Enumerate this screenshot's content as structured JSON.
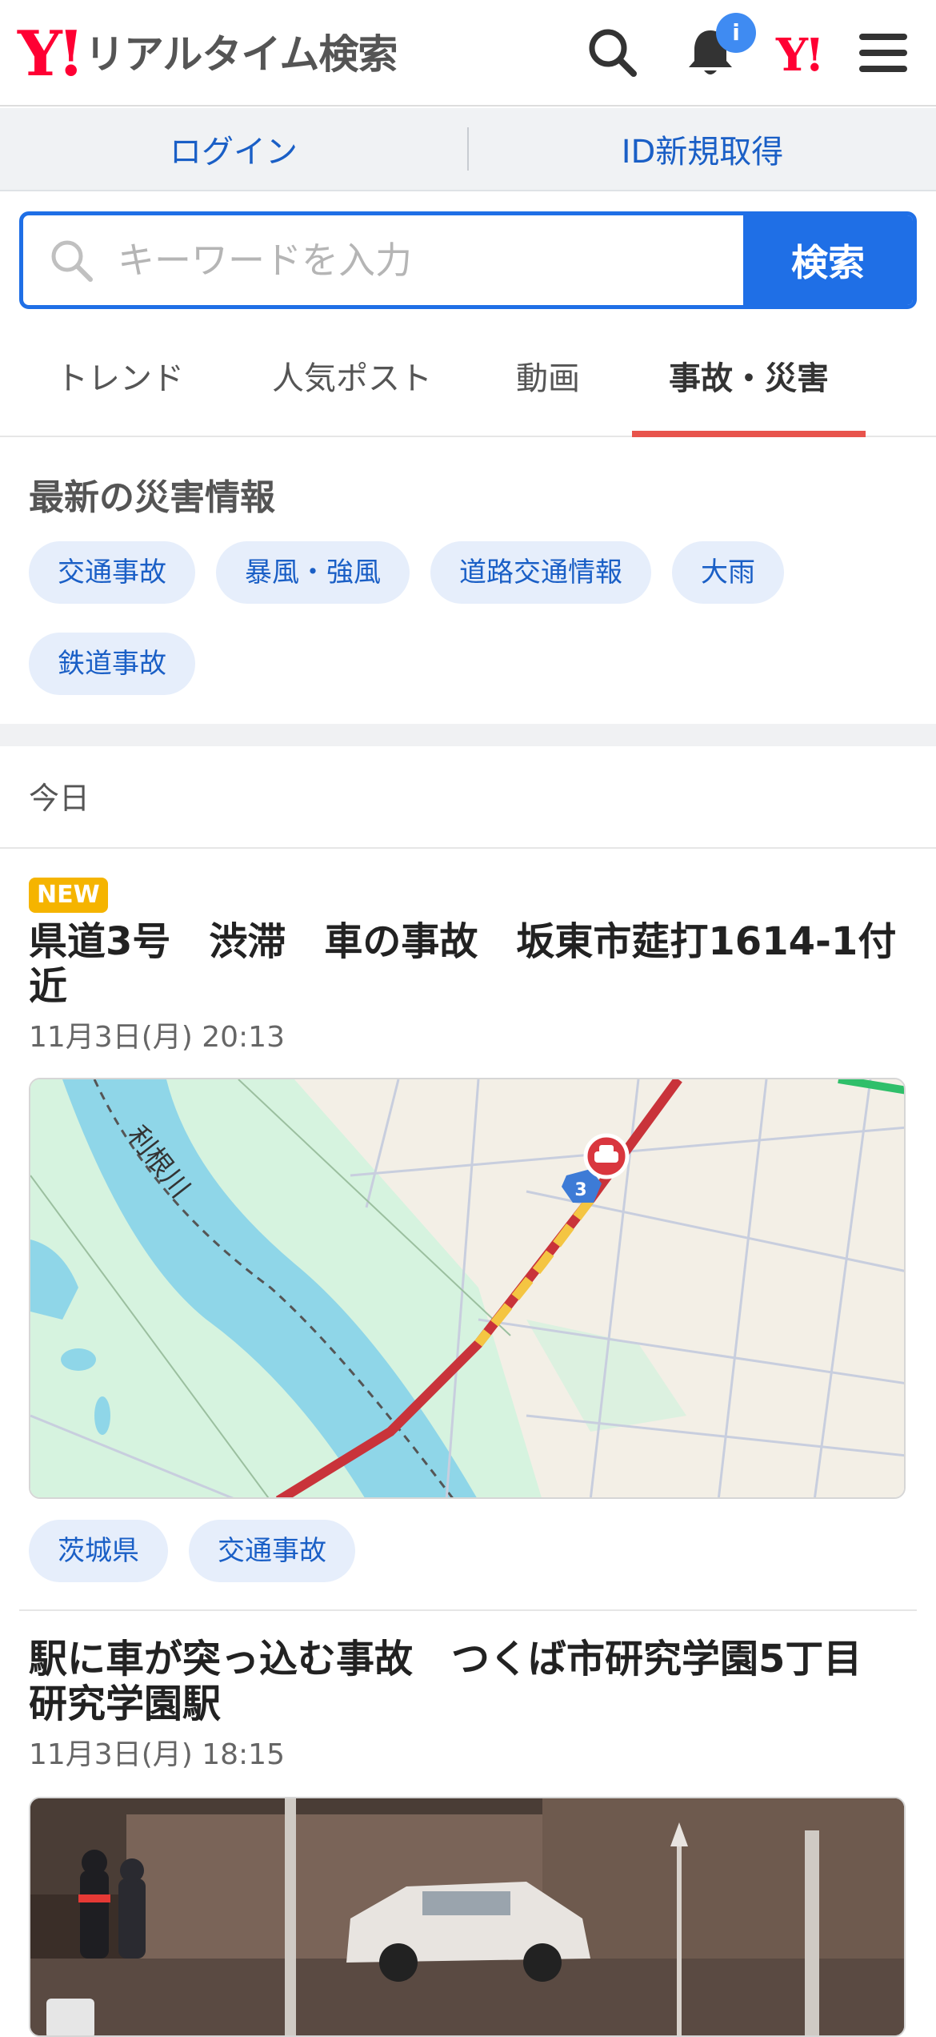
{
  "header": {
    "logo_mark": "Y!",
    "logo_text": "リアルタイム検索",
    "notification_badge": "i",
    "yahoo_mark": "Y!"
  },
  "loginbar": {
    "login": "ログイン",
    "register": "ID新規取得"
  },
  "search": {
    "placeholder": "キーワードを入力",
    "button": "検索"
  },
  "tabs": [
    {
      "label": "トレンド",
      "active": false
    },
    {
      "label": "人気ポスト",
      "active": false
    },
    {
      "label": "動画",
      "active": false
    },
    {
      "label": "事故・災害",
      "active": true
    }
  ],
  "disaster": {
    "title": "最新の災害情報",
    "chips": [
      "交通事故",
      "暴風・強風",
      "道路交通情報",
      "大雨",
      "鉄道事故"
    ]
  },
  "today_label": "今日",
  "articles": [
    {
      "badge": "NEW",
      "title": "県道3号　渋滞　車の事故　坂東市莚打1614-1付近",
      "time": "11月3日(月) 20:13",
      "map_river_label": "利根川",
      "map_route_number": "3",
      "tags": [
        "茨城県",
        "交通事故"
      ]
    },
    {
      "title": "駅に車が突っ込む事故　つくば市研究学園5丁目　研究学園駅",
      "time": "11月3日(月) 18:15"
    }
  ],
  "colors": {
    "brand_red": "#ff0033",
    "primary_blue": "#1f6fe6",
    "link_blue": "#1a5fc6",
    "tab_underline": "#e8544c",
    "new_badge": "#f5b400"
  },
  "icons": [
    "search-icon",
    "bell-icon",
    "menu-icon",
    "accident-icon"
  ]
}
